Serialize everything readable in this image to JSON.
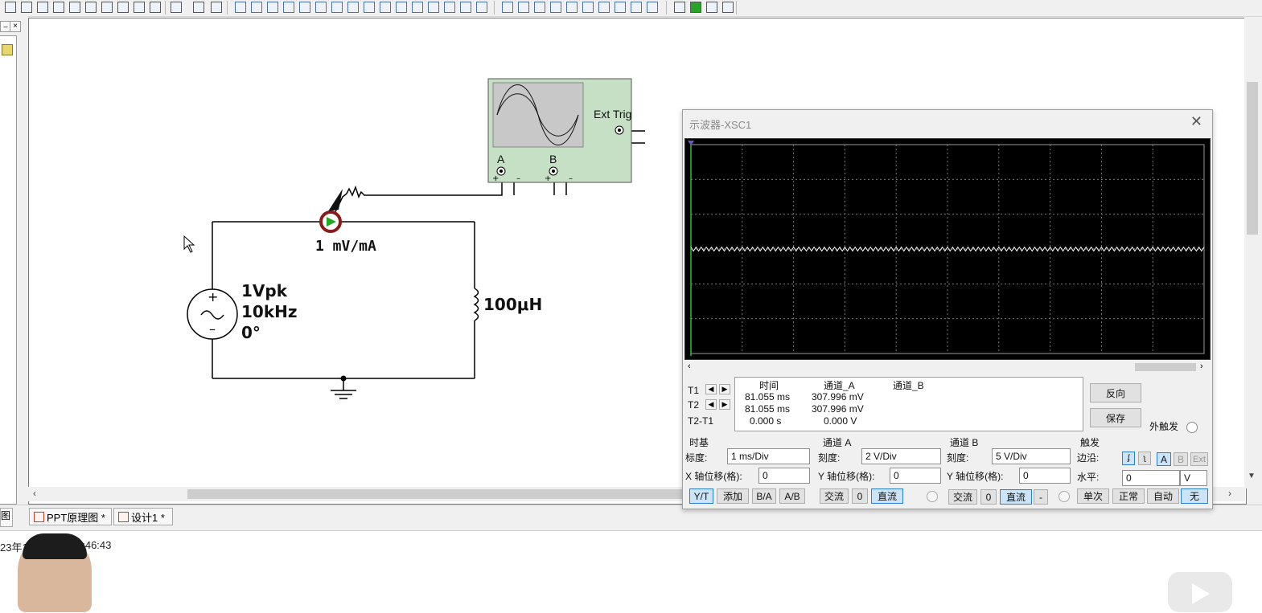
{
  "circuit": {
    "probe_label": "1 mV/mA",
    "source_lines": [
      "1Vpk",
      "10kHz",
      "0°"
    ],
    "inductor_label": "100μH",
    "scope_ext_trig": "Ext Trig",
    "scope_ch_a": "A",
    "scope_ch_b": "B"
  },
  "tabs": [
    {
      "label": "PPT原理图 *"
    },
    {
      "label": "设计1 *"
    }
  ],
  "timestamp_fragment_left": "23年1",
  "timestamp_fragment_right": "7:46:43",
  "oscilloscope": {
    "title": "示波器-XSC1",
    "readout": {
      "headers": [
        "时间",
        "通道_A",
        "通道_B"
      ],
      "rows": [
        {
          "label": "T1",
          "time": "81.055 ms",
          "a": "307.996 mV",
          "b": ""
        },
        {
          "label": "T2",
          "time": "81.055 ms",
          "a": "307.996 mV",
          "b": ""
        },
        {
          "label": "T2-T1",
          "time": "0.000 s",
          "a": "0.000 V",
          "b": ""
        }
      ]
    },
    "buttons": {
      "reverse": "反向",
      "save": "保存",
      "ext_trigger": "外触发"
    },
    "timebase": {
      "group": "时基",
      "scale_label": "标度:",
      "scale": "1 ms/Div",
      "xpos_label": "X 轴位移(格):",
      "xpos": "0",
      "modes": [
        "Y/T",
        "添加",
        "B/A",
        "A/B"
      ]
    },
    "channel_a": {
      "group": "通道 A",
      "scale_label": "刻度:",
      "scale": "2  V/Div",
      "ypos_label": "Y 轴位移(格):",
      "ypos": "0",
      "coupling": [
        "交流",
        "0",
        "直流"
      ]
    },
    "channel_b": {
      "group": "通道 B",
      "scale_label": "刻度:",
      "scale": "5  V/Div",
      "ypos_label": "Y 轴位移(格):",
      "ypos": "0",
      "coupling": [
        "交流",
        "0",
        "直流",
        "-"
      ]
    },
    "trigger": {
      "group": "触发",
      "edge_label": "边沿:",
      "sources": [
        "A",
        "B",
        "Ext"
      ],
      "level_label": "水平:",
      "level": "0",
      "level_unit": "V",
      "modes": [
        "单次",
        "正常",
        "自动",
        "无"
      ]
    }
  },
  "colors": {
    "trace": "#ffffff",
    "grid": "#7a7a7a",
    "scope_body": "#c5e0c5",
    "probe_ring": "#8b1a1a",
    "probe_arrow": "#22aa22",
    "active_button": "#cce4f7"
  }
}
